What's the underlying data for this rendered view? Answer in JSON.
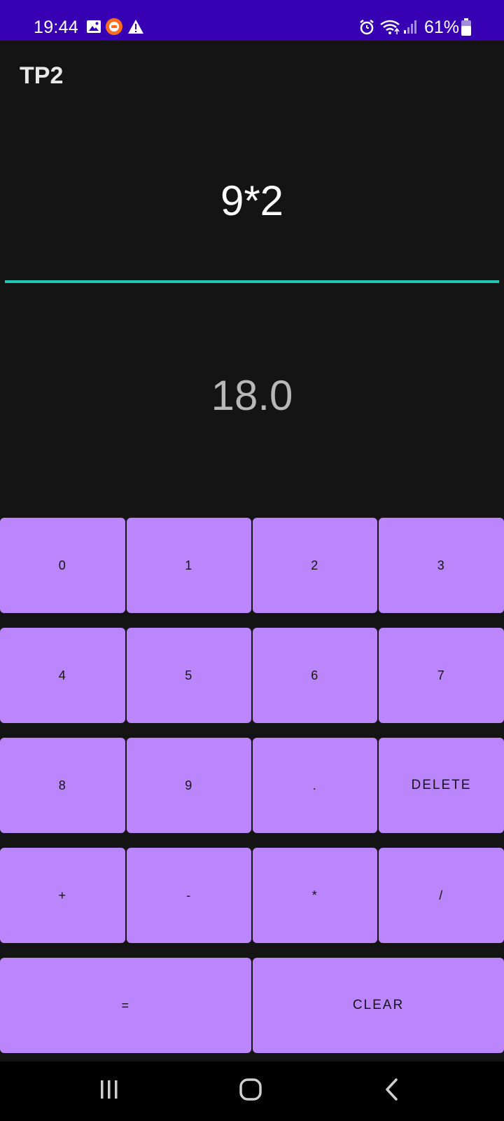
{
  "status_bar": {
    "time": "19:44",
    "battery_percent": "61%",
    "background": "#3700b3",
    "icons": [
      "gallery-icon",
      "notification-badge-icon",
      "warning-icon",
      "alarm-icon",
      "wifi-icon",
      "signal-icon",
      "battery-icon"
    ]
  },
  "app": {
    "title": "TP2",
    "expression": "9*2",
    "result": "18.0",
    "accent_color": "#1fc7b7",
    "key_color": "#bb86fc"
  },
  "keypad": {
    "rows": [
      [
        "0",
        "1",
        "2",
        "3"
      ],
      [
        "4",
        "5",
        "6",
        "7"
      ],
      [
        "8",
        "9",
        ".",
        "DELETE"
      ],
      [
        "+",
        "-",
        "*",
        "/"
      ],
      [
        "=",
        "CLEAR"
      ]
    ]
  },
  "nav_bar": {
    "buttons": [
      "recent-apps-icon",
      "home-icon",
      "back-icon"
    ]
  }
}
